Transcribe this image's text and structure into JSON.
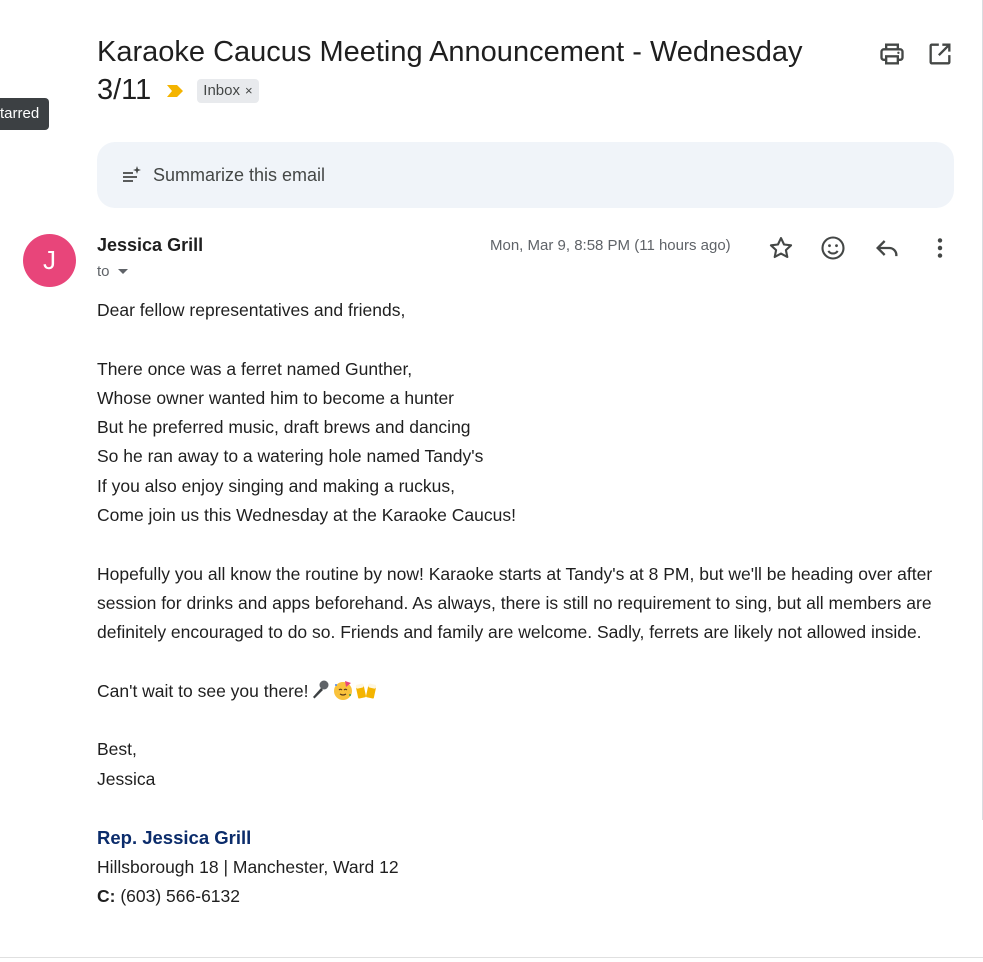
{
  "tooltip": {
    "text": "tarred"
  },
  "email": {
    "subject": "Karaoke Caucus Meeting Announcement - Wednesday 3/11",
    "label": "Inbox",
    "label_remove": "×",
    "importance_icon": "importance-marker-icon",
    "importance_color": "#f4b400"
  },
  "toolbar": {
    "print_icon": "print-icon",
    "popout_icon": "open-in-new-window-icon"
  },
  "summarize": {
    "label": "Summarize this email",
    "icon": "sparkle-summary-icon"
  },
  "sender": {
    "initial": "J",
    "avatar_color": "#e8457a",
    "name": "Jessica Grill",
    "to_label": "to",
    "timestamp": "Mon, Mar 9, 8:58 PM (11 hours ago)"
  },
  "actions": {
    "star_icon": "star-icon",
    "emoji_icon": "add-reaction-icon",
    "reply_icon": "reply-icon",
    "more_icon": "more-vertical-icon"
  },
  "body": {
    "greeting": "Dear fellow representatives and friends,",
    "poem": [
      "There once was a ferret named Gunther,",
      "Whose owner wanted him to become a hunter",
      "But he preferred music, draft brews and dancing",
      "So he ran away to a watering hole named Tandy's",
      "If you also enjoy singing and making a ruckus,",
      "Come join us this Wednesday at the Karaoke Caucus!"
    ],
    "paragraph": "Hopefully you all know the routine by now! Karaoke starts at Tandy's at 8 PM, but we'll be heading over after session for drinks and apps beforehand. As always, there is still no requirement to sing, but all members are definitely encouraged to do so. Friends and family are welcome. Sadly, ferrets are likely not allowed inside.",
    "closing_line": "Can't wait to see you there!",
    "closing_emojis": [
      "microphone-emoji",
      "party-face-emoji",
      "clinking-beer-mugs-emoji"
    ],
    "signoff": "Best,",
    "signoff_name": "Jessica"
  },
  "signature": {
    "name": "Rep. Jessica Grill",
    "district": "Hillsborough 18 | Manchester, Ward 12",
    "phone_label": "C:",
    "phone": " (603) 566-6132",
    "name_color": "#0b2c6b"
  }
}
